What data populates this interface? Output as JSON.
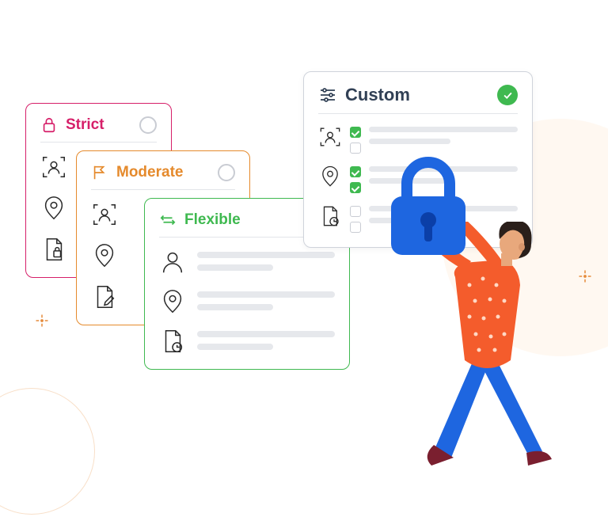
{
  "cards": {
    "strict": {
      "label": "Strict"
    },
    "moderate": {
      "label": "Moderate"
    },
    "flexible": {
      "label": "Flexible"
    },
    "custom": {
      "label": "Custom"
    }
  },
  "colors": {
    "strict": "#d61f69",
    "moderate": "#e58a2c",
    "flexible": "#3fb950",
    "custom_title": "#314055",
    "check": "#3fb950",
    "lock": "#1e66e0",
    "shirt": "#f45c2c",
    "pants": "#1e66e0",
    "hair": "#2a1f1a",
    "skin": "#e8a87c",
    "shoe": "#7a1f2f"
  },
  "custom_checks": [
    [
      true,
      false
    ],
    [
      true,
      true
    ],
    [
      false,
      false
    ]
  ]
}
